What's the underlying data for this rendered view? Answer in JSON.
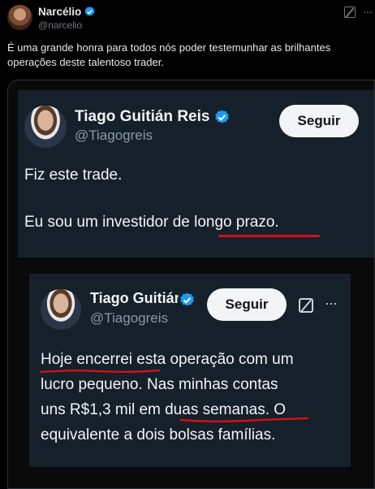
{
  "tweet": {
    "author_name": "Narcélio",
    "author_handle": "@narcelio",
    "text": "É uma grande honra para todos nós poder testemunhar as brilhantes operações deste talentoso trader.",
    "more_label": "···"
  },
  "embedded_post_1": {
    "author_name": "Tiago Guitián Reis",
    "author_handle": "@Tiagogreis",
    "follow_label": "Seguir",
    "line1": "Fiz este trade.",
    "line2": "Eu sou um investidor de longo prazo."
  },
  "embedded_post_2": {
    "author_name": "Tiago Guitián Reis",
    "author_handle": "@Tiagogreis",
    "follow_label": "Seguir",
    "more_label": "···",
    "lines": [
      "Hoje encerrei esta operação com um",
      "lucro pequeno. Nas minhas contas",
      "uns R$1,3 mil em duas semanas. O",
      "equivalente a dois bolsas famílias."
    ]
  },
  "colors": {
    "verified": "#1d9bf0",
    "underline": "#d40f1a",
    "screenshot_bg": "#15202b"
  }
}
